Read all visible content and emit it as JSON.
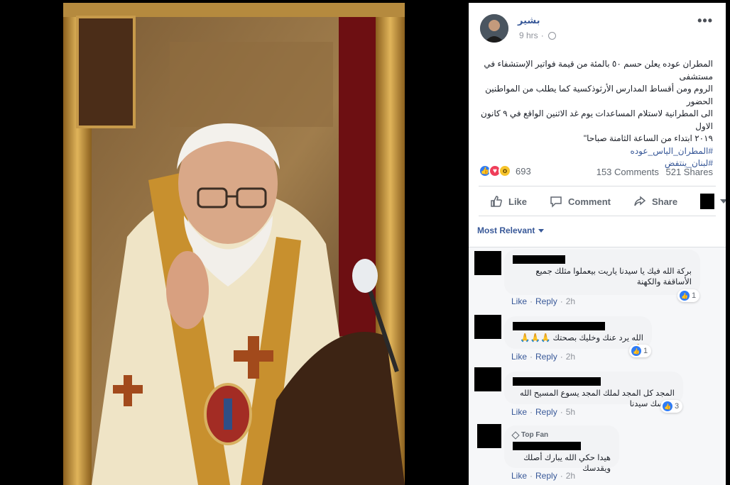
{
  "post": {
    "author": "بشير",
    "time": "9 hrs",
    "more_label": "•••",
    "text_lines": [
      "المطران عوده يعلن حسم ٥٠ بالمئة من قيمة فواتير الإستشفاء في مستشفى",
      "الروم ومن أقساط المدارس الأرثوذكسية كما يطلب من المواطنين الحضور",
      "الى المطرانية لاستلام المساعدات يوم غد الاثنين الواقع في ٩ كانون الاول",
      "٢٠١٩ ابتداء من الساعة الثامنة صباحا\""
    ],
    "hashtags": [
      "#المطران_الياس_عوده",
      "#لبنان_ينتفض"
    ],
    "reaction_count": "693",
    "comments_count": "153 Comments",
    "shares_count": "521 Shares"
  },
  "actions": {
    "like": "Like",
    "comment": "Comment",
    "share": "Share"
  },
  "sort": {
    "label": "Most Relevant"
  },
  "comments": [
    {
      "text": "بركة الله فيك يا سيدنا ياريت بيعملوا مثلك جميع الأساقفة والكهنة",
      "reactions": "1",
      "like": "Like",
      "reply": "Reply",
      "time": "2h"
    },
    {
      "text": "الله يرد عنك وخليك بصحتك 🙏🙏🙏🙏",
      "reactions": "1",
      "like": "Like",
      "reply": "Reply",
      "time": "2h"
    },
    {
      "text": "المجد كل المجد لملك المجد يسوع المسيح الله يقدسك سيدنا",
      "reactions": "3",
      "like": "Like",
      "reply": "Reply",
      "time": "5h"
    },
    {
      "badge": "Top Fan",
      "text": "هيدا حكي الله يبارك أصلك ويقدسك",
      "like": "Like",
      "reply": "Reply",
      "time": "2h"
    }
  ],
  "colors": {
    "link": "#385898",
    "muted": "#606770",
    "like_blue": "#2f7cf6",
    "love_red": "#ef3e5a",
    "wow_yellow": "#f7c42c"
  },
  "icons": [
    "globe-icon",
    "more-icon",
    "like-icon",
    "comment-icon",
    "share-icon",
    "chevron-down-icon",
    "diamond-icon"
  ]
}
